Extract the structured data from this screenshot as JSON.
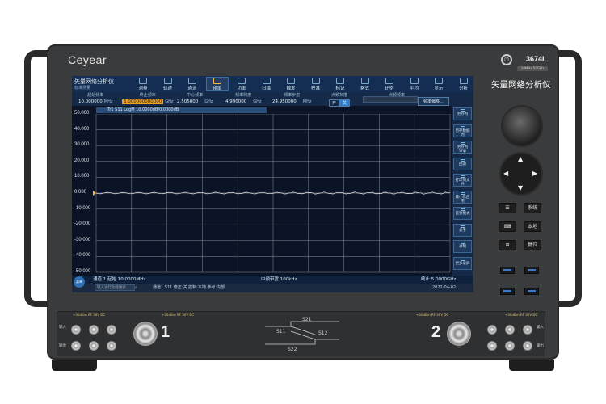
{
  "instrument": {
    "brand": "Ceyear",
    "model": "3674L",
    "model_badge": "10MHz-50GHz",
    "name_cn": "矢量网络分析仪"
  },
  "screen": {
    "title": "矢量网络分析仪",
    "subtitle": "标准测量",
    "tabs": [
      {
        "label": "测量",
        "icon": "measure-icon"
      },
      {
        "label": "轨迹",
        "icon": "trace-icon"
      },
      {
        "label": "通道",
        "icon": "channel-icon"
      },
      {
        "label": "频率",
        "icon": "frequency-icon",
        "active": true
      },
      {
        "label": "功率",
        "icon": "power-icon"
      },
      {
        "label": "扫描",
        "icon": "sweep-icon"
      },
      {
        "label": "触发",
        "icon": "trigger-icon"
      },
      {
        "label": "校准",
        "icon": "calibration-icon"
      },
      {
        "label": "标记",
        "icon": "marker-icon"
      },
      {
        "label": "格式",
        "icon": "format-icon"
      },
      {
        "label": "比例",
        "icon": "scale-icon"
      },
      {
        "label": "平均",
        "icon": "average-icon"
      },
      {
        "label": "显示",
        "icon": "display-icon"
      },
      {
        "label": "分析",
        "icon": "analysis-icon"
      }
    ],
    "params": {
      "start": {
        "label": "起始频率",
        "value": "10.000000",
        "unit": "MHz"
      },
      "stop": {
        "label": "终止频率",
        "value": "5.000000000000",
        "unit": "GHz"
      },
      "center": {
        "label": "中心频率",
        "value": "2.505000",
        "unit": "GHz"
      },
      "span": {
        "label": "频率跨度",
        "value": "4.990000",
        "unit": "GHz"
      },
      "step": {
        "label": "频率步进",
        "value": "24.950000",
        "unit": "MHz"
      },
      "cw": {
        "label": "点频扫描",
        "off": "开",
        "on": "关"
      },
      "cw_freq": {
        "label": "点频频率"
      },
      "offset_button": "频率偏移..."
    },
    "trace_tag": "Tr1 S11 LogM 10.0000dB/0.0000dB",
    "y_ticks": [
      "50.000",
      "40.000",
      "30.000",
      "20.000",
      "10.000",
      "0.000",
      "-10.000",
      "-20.000",
      "-30.000",
      "-40.000",
      "-50.000"
    ],
    "side_buttons": [
      "另存为",
      "另存数据为",
      "另存为Snp",
      "回调",
      "打印到文件",
      "最小化应用",
      "首要模式",
      "关于",
      "录制",
      "更多录屏"
    ],
    "status": {
      "left": "通道 1 起始 10.0000MHz",
      "mid": "中频带宽 100kHz",
      "right": "终止 5.0000GHz"
    },
    "bottom": {
      "menu": "菜单",
      "input_placeholder": "输入进行功能搜索",
      "info": "通道1 S11 修正:关 控制:本地 参考:内部",
      "datetime": "2022-04-02 17:15:01"
    }
  },
  "front_panel": {
    "buttons": [
      "系统",
      "本地",
      "复位"
    ],
    "port_labels": [
      "1",
      "2"
    ],
    "warn_text": "+30dBm RF 30V DC",
    "s_params": [
      "S21",
      "S11",
      "S12",
      "S22"
    ],
    "in_label": "输入",
    "out_label": "输出"
  },
  "colors": {
    "screen_bg": "#0b1426",
    "topbar": "#132e52",
    "highlight": "#f0a020",
    "grid": "#8a8f98",
    "trace": "#e8e8e8"
  }
}
